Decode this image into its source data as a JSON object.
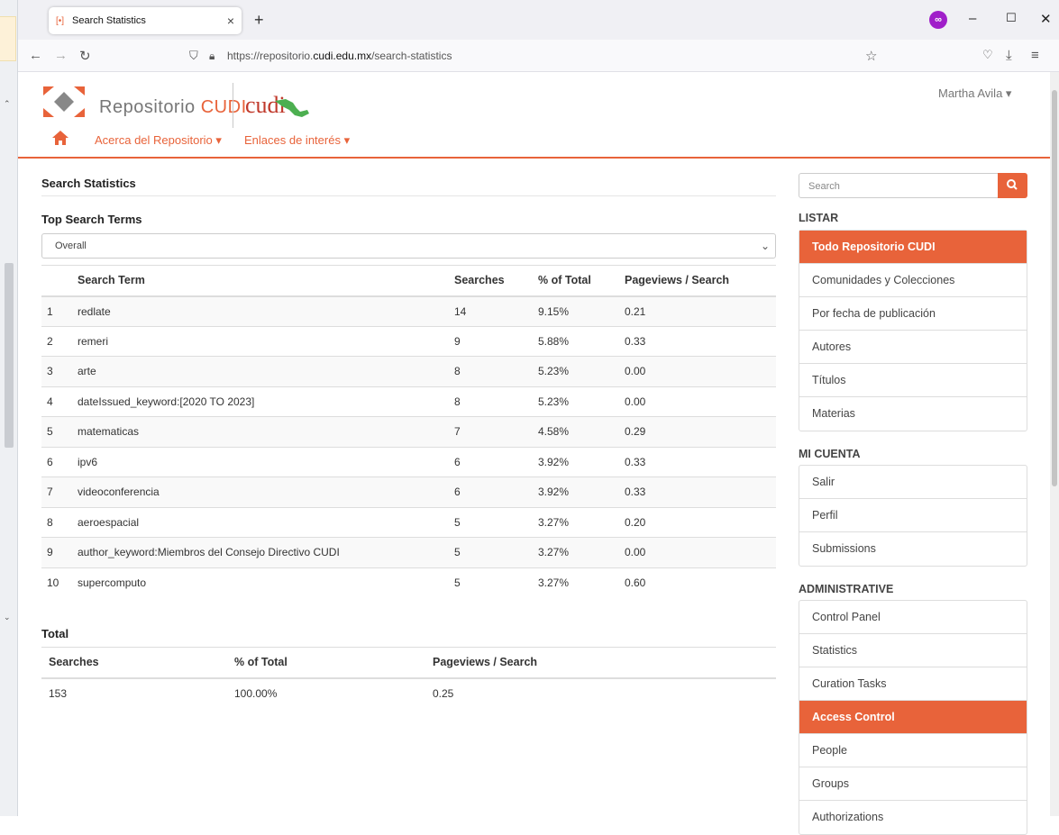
{
  "browser": {
    "tab_title": "Search Statistics",
    "url_prefix": "https://repositorio.",
    "url_domain": "cudi.edu.mx",
    "url_path": "/search-statistics"
  },
  "header": {
    "logo_text": "Repositorio",
    "logo_accent": "CUDI",
    "partner_logo": "cudi",
    "user_name": "Martha Avila",
    "menu": [
      "Acerca del Repositorio",
      "Enlaces de interés"
    ]
  },
  "main": {
    "page_title": "Search Statistics",
    "top_terms_title": "Top Search Terms",
    "select_value": "Overall",
    "columns": [
      "Search Term",
      "Searches",
      "% of Total",
      "Pageviews / Search"
    ],
    "rows": [
      {
        "rank": "1",
        "term": "redlate",
        "searches": "14",
        "pct": "9.15%",
        "pv": "0.21"
      },
      {
        "rank": "2",
        "term": "remeri",
        "searches": "9",
        "pct": "5.88%",
        "pv": "0.33"
      },
      {
        "rank": "3",
        "term": "arte",
        "searches": "8",
        "pct": "5.23%",
        "pv": "0.00"
      },
      {
        "rank": "4",
        "term": "dateIssued_keyword:[2020 TO 2023]",
        "searches": "8",
        "pct": "5.23%",
        "pv": "0.00"
      },
      {
        "rank": "5",
        "term": "matematicas",
        "searches": "7",
        "pct": "4.58%",
        "pv": "0.29"
      },
      {
        "rank": "6",
        "term": "ipv6",
        "searches": "6",
        "pct": "3.92%",
        "pv": "0.33"
      },
      {
        "rank": "7",
        "term": "videoconferencia",
        "searches": "6",
        "pct": "3.92%",
        "pv": "0.33"
      },
      {
        "rank": "8",
        "term": "aeroespacial",
        "searches": "5",
        "pct": "3.27%",
        "pv": "0.20"
      },
      {
        "rank": "9",
        "term": "author_keyword:Miembros del Consejo Directivo CUDI",
        "searches": "5",
        "pct": "3.27%",
        "pv": "0.00"
      },
      {
        "rank": "10",
        "term": "supercomputo",
        "searches": "5",
        "pct": "3.27%",
        "pv": "0.60"
      }
    ],
    "total_title": "Total",
    "total_columns": [
      "Searches",
      "% of Total",
      "Pageviews / Search"
    ],
    "total_values": [
      "153",
      "100.00%",
      "0.25"
    ]
  },
  "sidebar": {
    "search_placeholder": "Search",
    "sections": [
      {
        "title": "LISTAR",
        "items": [
          "Todo Repositorio CUDI",
          "Comunidades y Colecciones",
          "Por fecha de publicación",
          "Autores",
          "Títulos",
          "Materias"
        ]
      },
      {
        "title": "MI CUENTA",
        "items": [
          "Salir",
          "Perfil",
          "Submissions"
        ]
      },
      {
        "title": "ADMINISTRATIVE",
        "items": [
          "Control Panel",
          "Statistics",
          "Curation Tasks",
          "Access Control",
          "People",
          "Groups",
          "Authorizations"
        ]
      }
    ],
    "active_items": [
      "Todo Repositorio CUDI",
      "Access Control"
    ]
  },
  "colors": {
    "accent": "#e8633a",
    "logo_red": "#c0392b",
    "map_green": "#4caf50"
  },
  "icons": [
    "home-icon",
    "search-icon",
    "chevron-down-icon",
    "lock-icon",
    "shield-icon",
    "star-icon",
    "download-icon",
    "back-icon",
    "forward-icon",
    "reload-icon"
  ]
}
